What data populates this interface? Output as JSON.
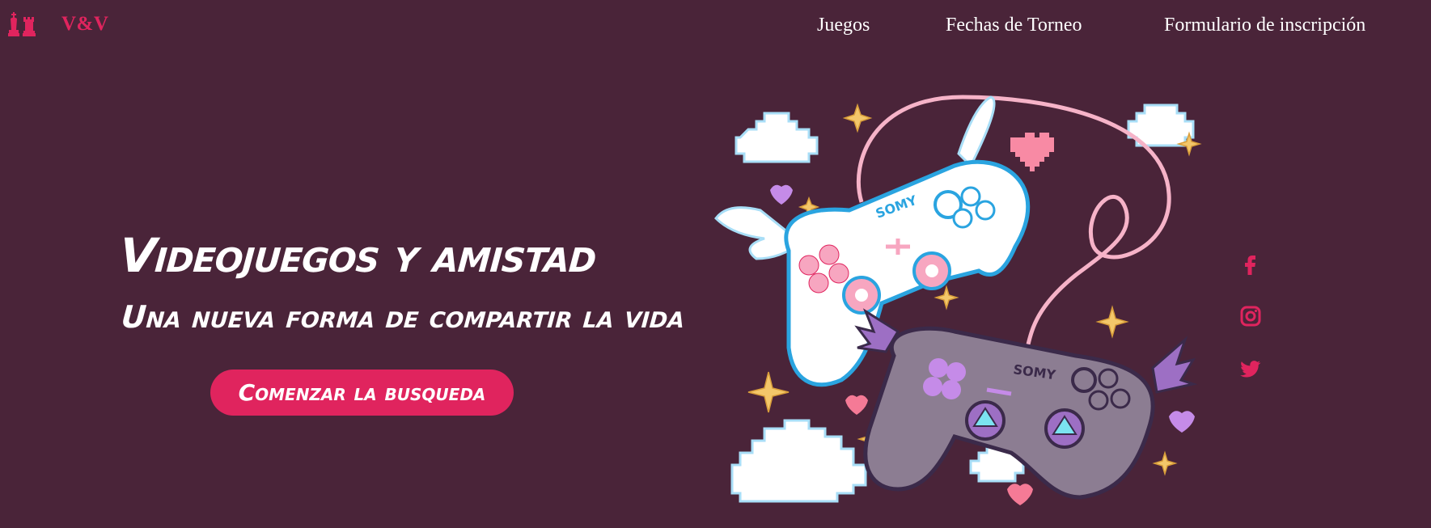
{
  "brand": {
    "name": "V&V",
    "icon": "chess-pieces-icon"
  },
  "nav": {
    "items": [
      {
        "label": "Juegos"
      },
      {
        "label": "Fechas de Torneo"
      },
      {
        "label": "Formulario de inscripción"
      }
    ]
  },
  "hero": {
    "title": "Videojuegos y amistad",
    "subtitle": "Una nueva forma de compartir la vida",
    "cta_label": "Comenzar la busqueda"
  },
  "illustration": {
    "controller_text_top": "SOMY",
    "controller_text_bottom": "SOMY"
  },
  "social": [
    {
      "icon": "facebook-icon"
    },
    {
      "icon": "instagram-icon"
    },
    {
      "icon": "twitter-icon"
    }
  ],
  "colors": {
    "background": "#4a2439",
    "accent": "#e0245e",
    "text": "#ffffff"
  }
}
